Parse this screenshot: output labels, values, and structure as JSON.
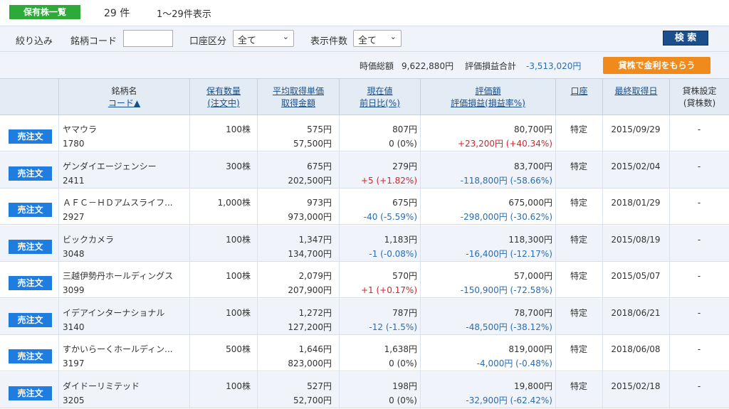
{
  "header": {
    "badge": "保有株一覧",
    "count": "29 件",
    "range": "1〜29件表示"
  },
  "filter": {
    "refine": "絞り込み",
    "code_label": "銘柄コード",
    "code_value": "",
    "account_label": "口座区分",
    "account_value": "全て",
    "display_label": "表示件数",
    "display_value": "全て",
    "search": "検 索"
  },
  "totals": {
    "market_label": "時価総額",
    "market_value": "9,622,880円",
    "pl_label": "評価損益合計",
    "pl_value": "-3,513,020円",
    "lend_button": "貸株で金利をもらう"
  },
  "columns": {
    "name": "銘柄名",
    "code": "コード▲",
    "qty": "保有数量",
    "qty_sub": "(注文中)",
    "avg": "平均取得単価",
    "cost": "取得金額",
    "price": "現在値",
    "change": "前日比(%)",
    "eval": "評価額",
    "eval_sub": "評価損益(損益率%)",
    "account": "口座",
    "last": "最終取得日",
    "lend": "貸株設定",
    "lend_sub": "(貸株数)"
  },
  "sell_label": "売注文",
  "rows": [
    {
      "name": "ヤマウラ",
      "code": "1780",
      "qty": "100株",
      "avg": "575円",
      "cost": "57,500円",
      "price": "807円",
      "change": "0 (0%)",
      "change_cls": "",
      "eval": "80,700円",
      "pl": "+23,200円 (+40.34%)",
      "pl_cls": "pos",
      "account": "特定",
      "date": "2015/09/29",
      "lend": "-"
    },
    {
      "name": "ゲンダイエージェンシー",
      "code": "2411",
      "qty": "300株",
      "avg": "675円",
      "cost": "202,500円",
      "price": "279円",
      "change": "+5 (+1.82%)",
      "change_cls": "pos",
      "eval": "83,700円",
      "pl": "-118,800円 (-58.66%)",
      "pl_cls": "neg",
      "account": "特定",
      "date": "2015/02/04",
      "lend": "-"
    },
    {
      "name": "ＡＦＣ－ＨＤアムスライフ...",
      "code": "2927",
      "qty": "1,000株",
      "avg": "973円",
      "cost": "973,000円",
      "price": "675円",
      "change": "-40 (-5.59%)",
      "change_cls": "neg",
      "eval": "675,000円",
      "pl": "-298,000円 (-30.62%)",
      "pl_cls": "neg",
      "account": "特定",
      "date": "2018/01/29",
      "lend": "-"
    },
    {
      "name": "ビックカメラ",
      "code": "3048",
      "qty": "100株",
      "avg": "1,347円",
      "cost": "134,700円",
      "price": "1,183円",
      "change": "-1 (-0.08%)",
      "change_cls": "neg",
      "eval": "118,300円",
      "pl": "-16,400円 (-12.17%)",
      "pl_cls": "neg",
      "account": "特定",
      "date": "2015/08/19",
      "lend": "-"
    },
    {
      "name": "三越伊勢丹ホールディングス",
      "code": "3099",
      "qty": "100株",
      "avg": "2,079円",
      "cost": "207,900円",
      "price": "570円",
      "change": "+1 (+0.17%)",
      "change_cls": "pos",
      "eval": "57,000円",
      "pl": "-150,900円 (-72.58%)",
      "pl_cls": "neg",
      "account": "特定",
      "date": "2015/05/07",
      "lend": "-"
    },
    {
      "name": "イデアインターナショナル",
      "code": "3140",
      "qty": "100株",
      "avg": "1,272円",
      "cost": "127,200円",
      "price": "787円",
      "change": "-12 (-1.5%)",
      "change_cls": "neg",
      "eval": "78,700円",
      "pl": "-48,500円 (-38.12%)",
      "pl_cls": "neg",
      "account": "特定",
      "date": "2018/06/21",
      "lend": "-"
    },
    {
      "name": "すかいらーくホールディン...",
      "code": "3197",
      "qty": "500株",
      "avg": "1,646円",
      "cost": "823,000円",
      "price": "1,638円",
      "change": "0 (0%)",
      "change_cls": "",
      "eval": "819,000円",
      "pl": "-4,000円 (-0.48%)",
      "pl_cls": "neg",
      "account": "特定",
      "date": "2018/06/08",
      "lend": "-"
    },
    {
      "name": "ダイドーリミテッド",
      "code": "3205",
      "qty": "100株",
      "avg": "527円",
      "cost": "52,700円",
      "price": "198円",
      "change": "0 (0%)",
      "change_cls": "",
      "eval": "19,800円",
      "pl": "-32,900円 (-62.42%)",
      "pl_cls": "neg",
      "account": "特定",
      "date": "2015/02/18",
      "lend": "-"
    }
  ],
  "colors": {
    "badge": "#2eaa3a",
    "search": "#1a4f8b",
    "lend": "#f18a1c",
    "sell": "#1f7de0",
    "positive": "#d0262f",
    "negative": "#2b6cb0"
  }
}
